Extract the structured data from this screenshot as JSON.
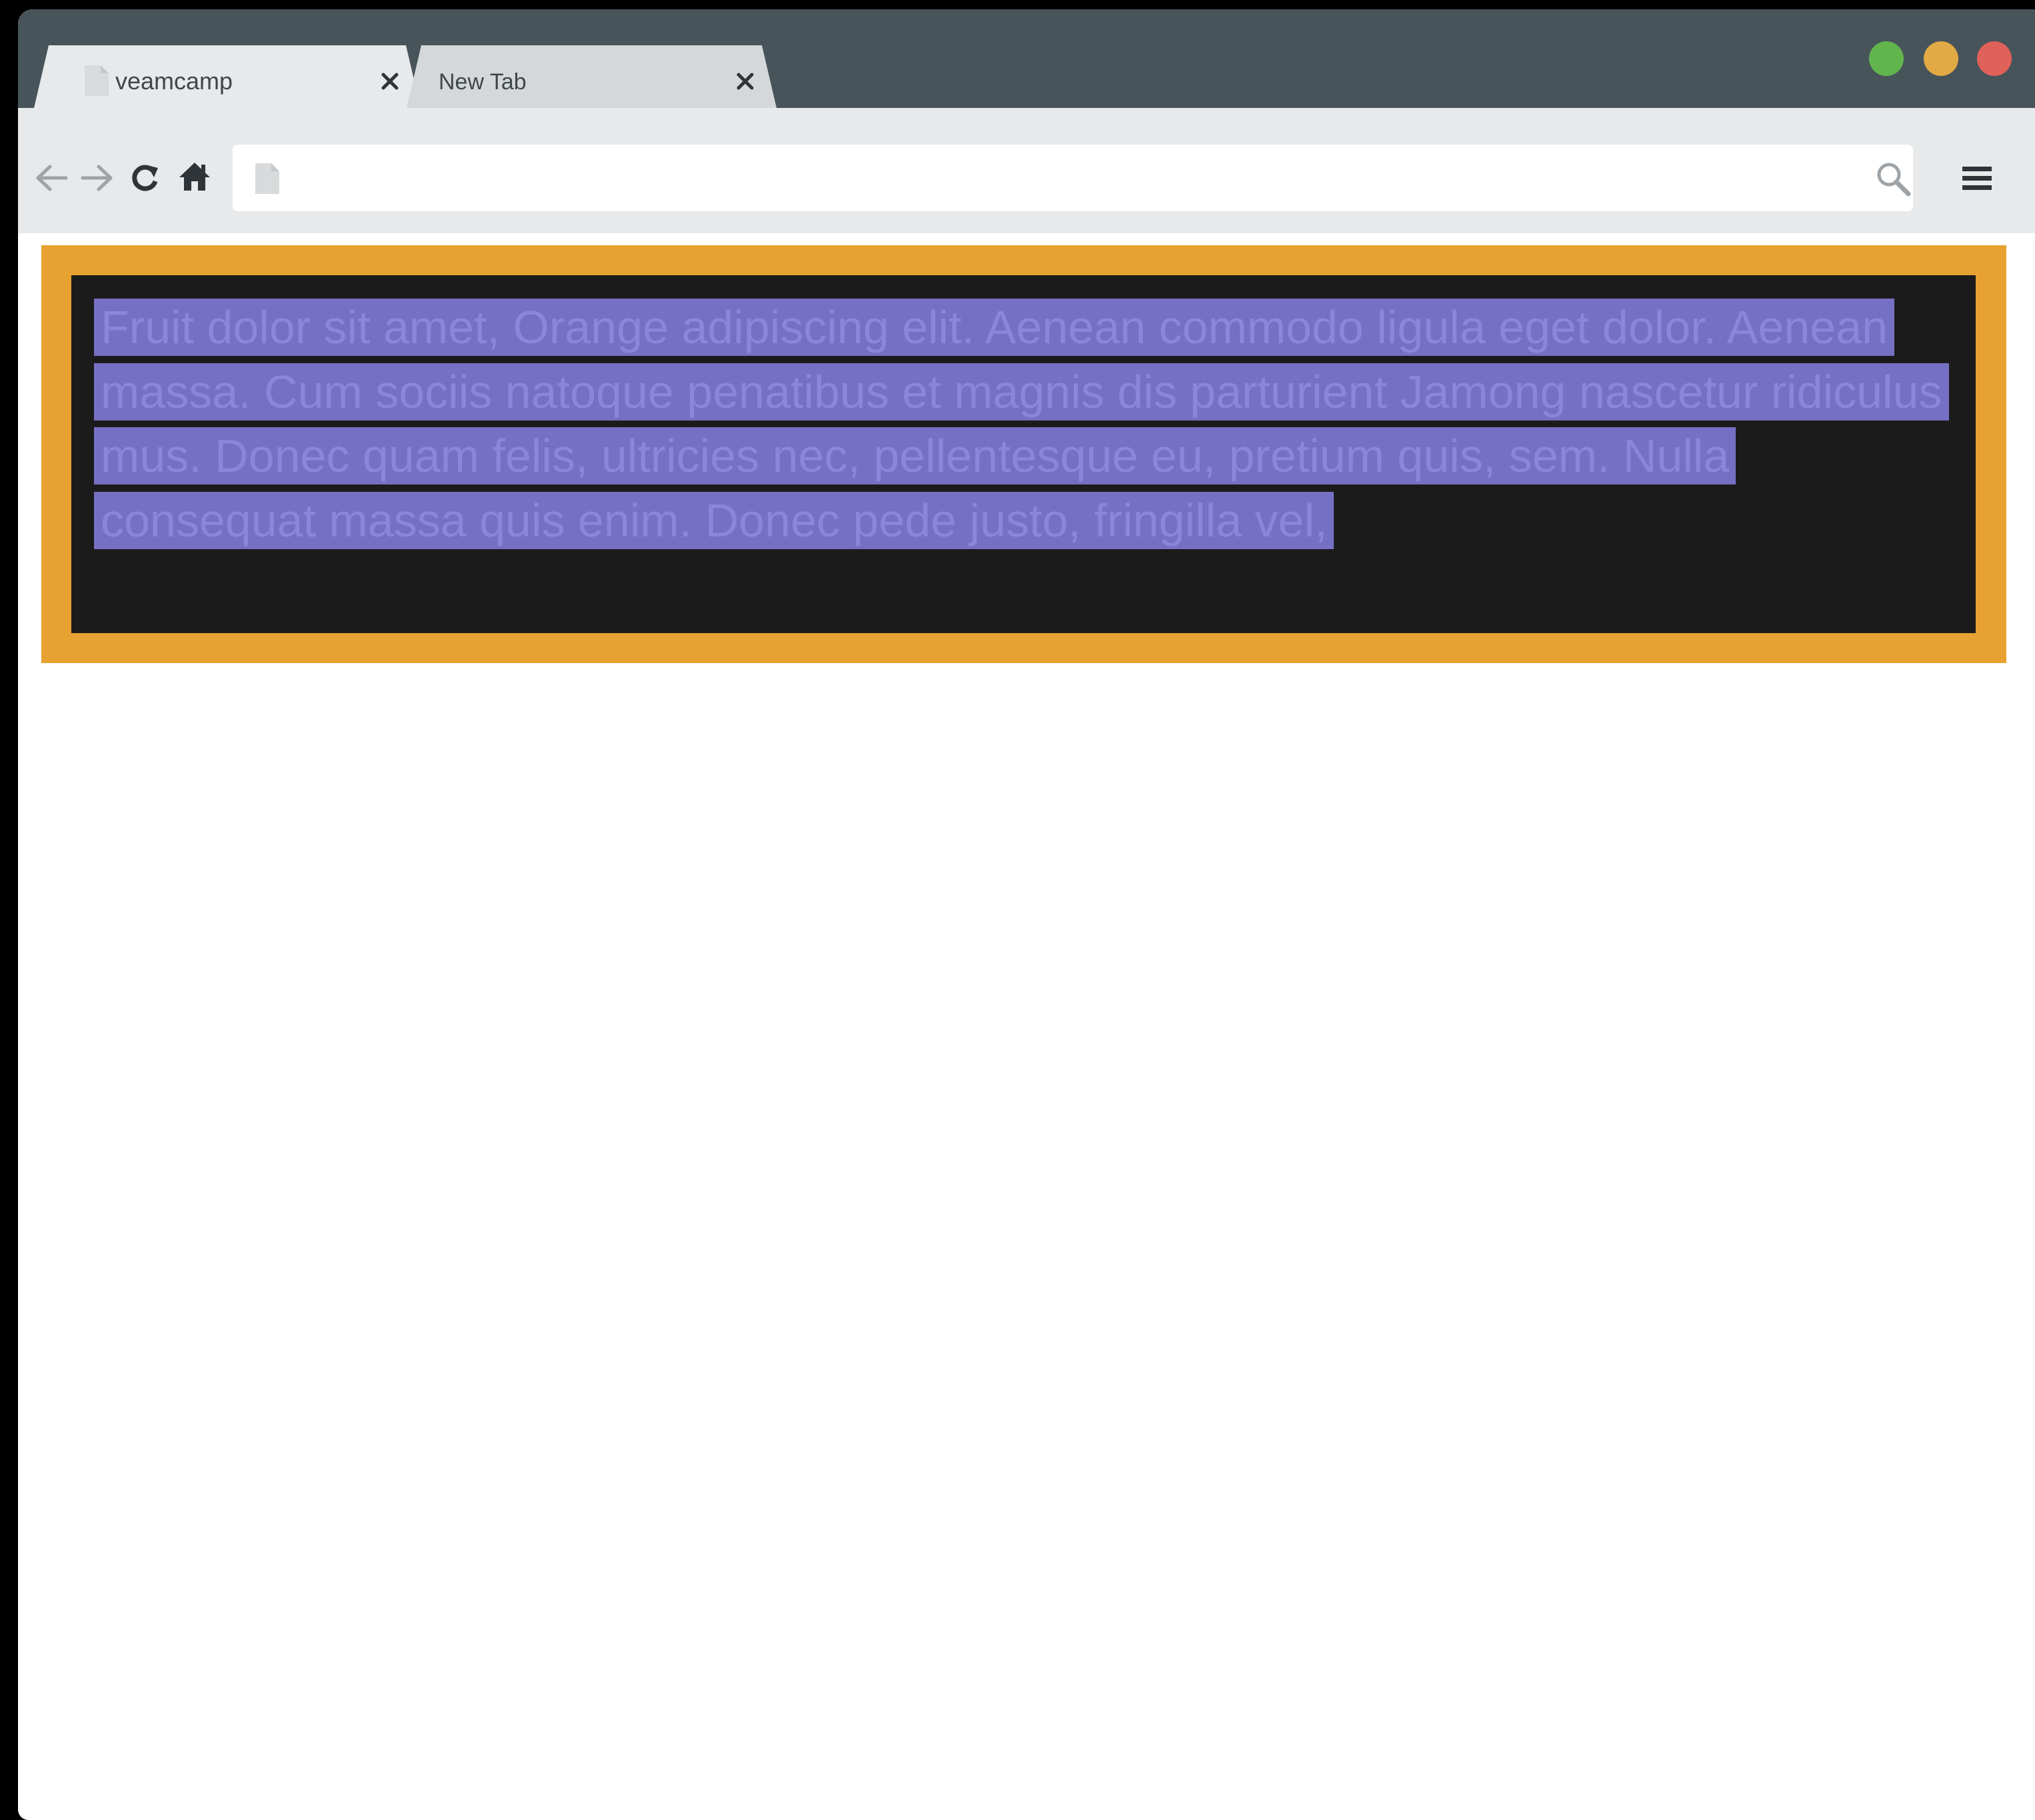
{
  "browser": {
    "tabs": [
      {
        "label": "veamcamp",
        "active": true
      },
      {
        "label": "New Tab",
        "active": false
      }
    ],
    "window_controls": [
      "green",
      "yellow",
      "red"
    ],
    "address_bar": {
      "value": "",
      "placeholder": ""
    },
    "colors": {
      "titlebar": "#47545a",
      "toolbar": "#e7e9ea",
      "green": "#62b54d",
      "yellow": "#e2aa45",
      "red": "#df615a"
    }
  },
  "page": {
    "paragraph": "Fruit dolor sit amet, Orange adipiscing elit. Aenean commodo ligula eget dolor. Aenean massa. Cum sociis natoque penatibus et magnis dis parturient Jamong nascetur ridiculus mus. Donec quam felis, ultricies nec, pellentesque eu, pretium quis, sem. Nulla consequat massa quis enim. Donec pede justo, fringilla vel,",
    "colors": {
      "frame": "#e7a232",
      "panel": "#1b1b1b",
      "selection": "#7670c4"
    }
  }
}
